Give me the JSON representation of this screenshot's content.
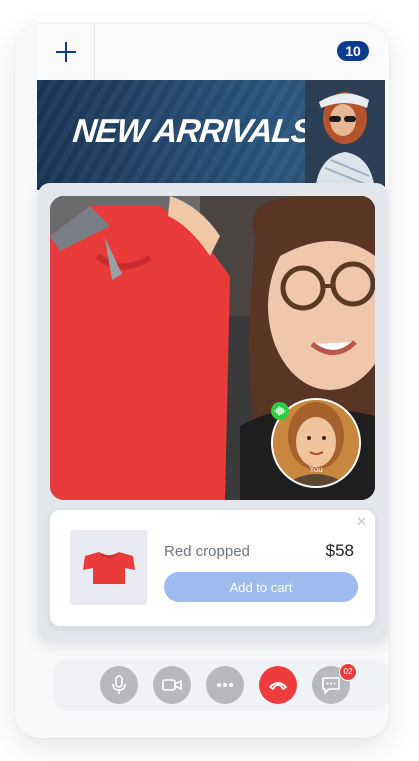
{
  "topbar": {
    "add_icon": "plus-icon",
    "notification_count": "10",
    "badge_color": "#0d3b8e"
  },
  "banner": {
    "title": "NEW ARRIVALS"
  },
  "call": {
    "self_label": "You",
    "audio_indicator_icon": "audio-wave-icon",
    "audio_color": "#2ecc40"
  },
  "product": {
    "name": "Red cropped",
    "price": "$58",
    "cta": "Add to cart",
    "close_icon": "close-icon",
    "cta_color": "#9dbbef",
    "product_color": "#ea3b3b"
  },
  "controls": {
    "buttons": [
      "microphone-icon",
      "camera-icon",
      "more-icon",
      "end-call-icon",
      "chat-icon"
    ],
    "chat_badge": "02",
    "end_call_color": "#ee3b3b"
  }
}
